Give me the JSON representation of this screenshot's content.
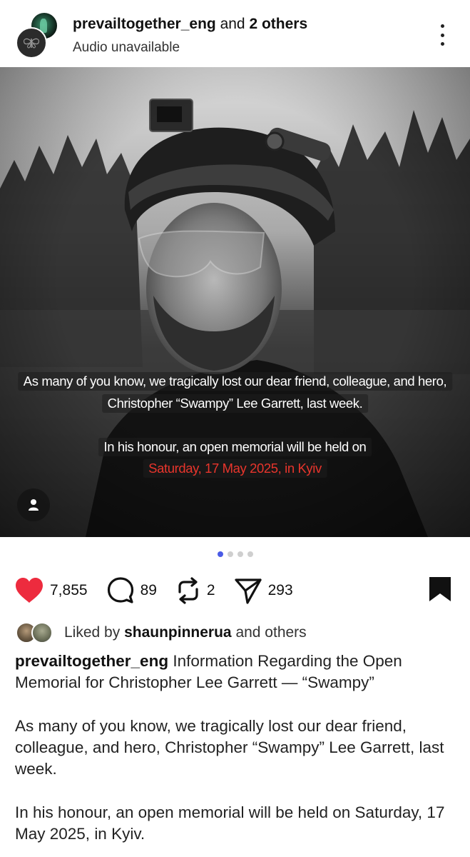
{
  "header": {
    "username": "prevailtogether_eng",
    "and_text": "and",
    "others": "2 others",
    "subtitle": "Audio unavailable"
  },
  "photo": {
    "overlay_line1": "As many of you know, we tragically lost our dear friend, colleague, and hero,",
    "overlay_line2": "Christopher “Swampy” Lee Garrett, last week.",
    "overlay_line3": "In his honour, an open memorial will be held on",
    "overlay_line4": "Saturday, 17 May 2025, in Kyiv",
    "carousel_index": 1,
    "carousel_total": 4
  },
  "actions": {
    "likes": "7,855",
    "comments": "89",
    "reposts": "2",
    "shares": "293"
  },
  "likes_row": {
    "prefix": "Liked by",
    "user": "shaunpinnerua",
    "suffix": "and others"
  },
  "caption": {
    "username": "prevailtogether_eng",
    "heading": "Information Regarding the Open Memorial for Christopher Lee Garrett — “Swampy”",
    "paragraph1": "As many of you know, we tragically lost our dear friend, colleague, and hero, Christopher “Swampy” Lee Garrett, last week.",
    "paragraph2": "In his honour, an open memorial will be held on Saturday, 17 May 2025, in Kyiv."
  },
  "colors": {
    "like_red": "#ed2b3e",
    "dot_active": "#4a5be6",
    "overlay_red": "#e8352c"
  },
  "icons": [
    "more-vertical-icon",
    "person-tag-icon",
    "heart-icon",
    "comment-icon",
    "repost-icon",
    "share-icon",
    "bookmark-icon"
  ]
}
